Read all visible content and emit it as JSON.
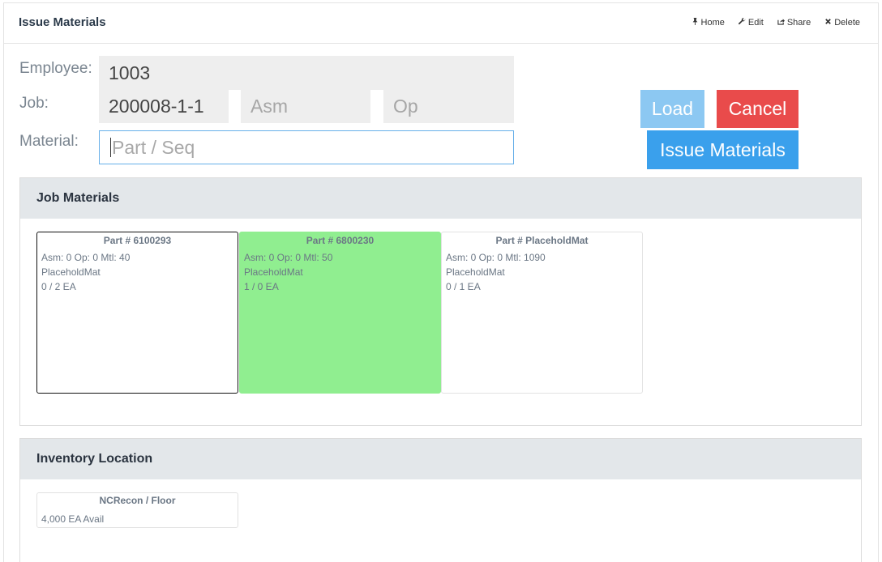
{
  "header": {
    "title": "Issue Materials",
    "actions": [
      {
        "label": "Home",
        "icon": "pin-icon"
      },
      {
        "label": "Edit",
        "icon": "wrench-icon"
      },
      {
        "label": "Share",
        "icon": "share-icon"
      },
      {
        "label": "Delete",
        "icon": "close-icon"
      }
    ]
  },
  "form": {
    "employee_label": "Employee:",
    "employee_value": "1003",
    "job_label": "Job:",
    "job_value": "200008-1-1",
    "asm_placeholder": "Asm",
    "op_placeholder": "Op",
    "material_label": "Material:",
    "material_placeholder": "Part / Seq"
  },
  "buttons": {
    "load": "Load",
    "cancel": "Cancel",
    "issue": "Issue Materials"
  },
  "colors": {
    "load": "#8cc8f2",
    "cancel": "#e94b4b",
    "issue": "#3aa0ec",
    "issued_card": "#90ee90"
  },
  "job_materials": {
    "title": "Job Materials",
    "cards": [
      {
        "title": "Part # 6100293",
        "line1": "Asm: 0 Op: 0 Mtl: 40",
        "line2": "PlaceholdMat",
        "line3": "0 / 2 EA"
      },
      {
        "title": "Part # 6800230",
        "line1": "Asm: 0 Op: 0 Mtl: 50",
        "line2": "PlaceholdMat",
        "line3": "1 / 0 EA"
      },
      {
        "title": "Part # PlaceholdMat",
        "line1": "Asm: 0 Op: 0 Mtl: 1090",
        "line2": "PlaceholdMat",
        "line3": "0 / 1 EA"
      }
    ]
  },
  "inventory_location": {
    "title": "Inventory Location",
    "cards": [
      {
        "title": "NCRecon / Floor",
        "line1": "4,000 EA Avail"
      }
    ]
  }
}
